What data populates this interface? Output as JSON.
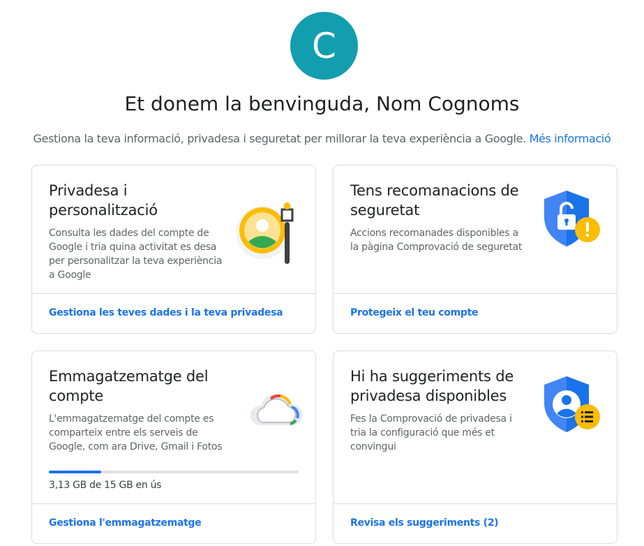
{
  "profile": {
    "avatar_letter": "C",
    "avatar_color": "#129eaf"
  },
  "header": {
    "title": "Et donem la benvinguda, Nom Cognoms",
    "subtitle": "Gestiona la teva informació, privadesa i seguretat per millorar la teva experiència a Google.",
    "more_info_link": "Més informació"
  },
  "cards": {
    "privacy": {
      "title": "Privadesa i personalització",
      "description": "Consulta les dades del compte de Google i tria quina activitat es desa per personalitzar la teva experiència a Google",
      "link": "Gestiona les teves dades i la teva privadesa",
      "icon": "privacy-personalization-icon"
    },
    "security": {
      "title": "Tens recomanacions de seguretat",
      "description": "Accions recomanades disponibles a la pàgina Comprovació de seguretat",
      "link": "Protegeix el teu compte",
      "icon": "security-shield-warning-icon"
    },
    "storage": {
      "title": "Emmagatzematge del compte",
      "description": "L'emmagatzematge del compte es comparteix entre els serveis de Google, com ara Drive, Gmail i Fotos",
      "usage_text": "3,13 GB de 15 GB en ús",
      "used_fraction": 0.2087,
      "link": "Gestiona l'emmagatzematge",
      "icon": "cloud-storage-icon"
    },
    "privacy_suggestions": {
      "title": "Hi ha suggeriments de privadesa disponibles",
      "description": "Fes la Comprovació de privadesa i tria la configuració que més et convingui",
      "link": "Revisa els suggeriments (2)",
      "icon": "privacy-check-shield-icon"
    }
  },
  "colors": {
    "accent": "#1a73e8",
    "warning": "#fbbc04",
    "shield_blue": "#4285f4",
    "text_primary": "#202124",
    "text_secondary": "#5f6368"
  }
}
